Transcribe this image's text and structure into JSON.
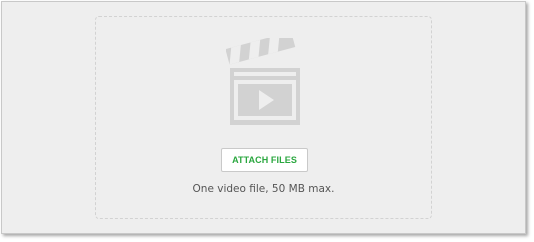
{
  "upload": {
    "icon": "video-clapperboard-icon",
    "attach_label": "ATTACH FILES",
    "hint": "One video file, 50 MB max."
  },
  "colors": {
    "panel_background": "#eeeeee",
    "icon_color": "#d2d2d2",
    "button_text": "#2aa73f",
    "hint_text": "#555555"
  }
}
